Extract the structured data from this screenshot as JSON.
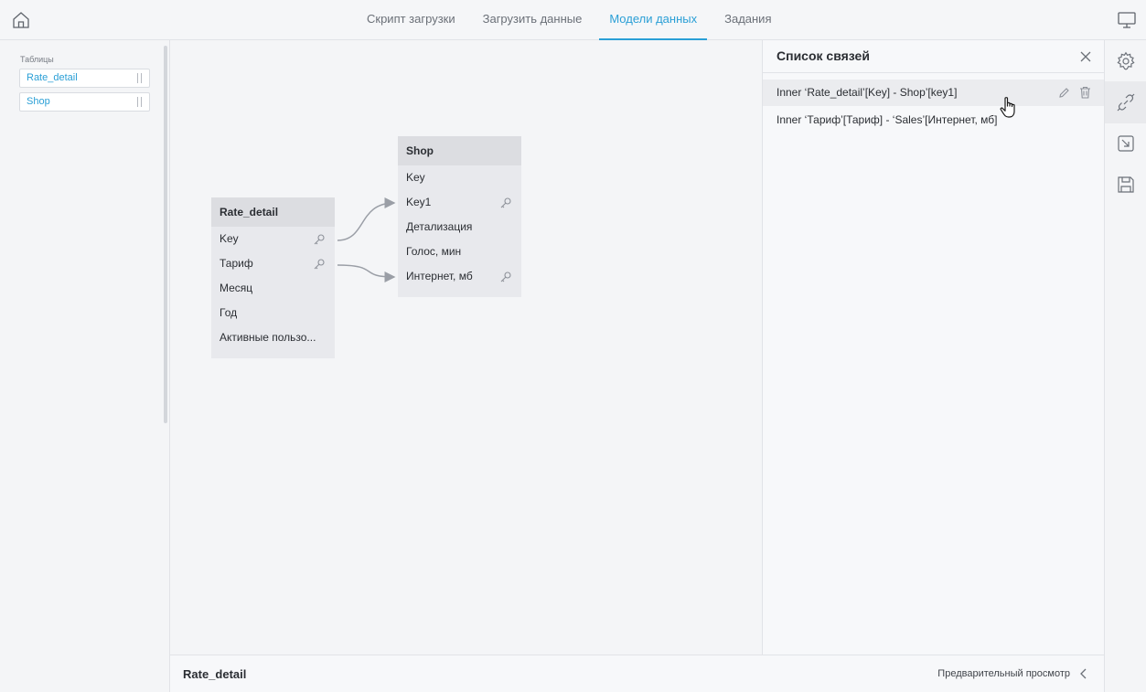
{
  "topbar": {
    "home_icon": "home-icon",
    "monitor_icon": "monitor-icon",
    "tabs": [
      {
        "label": "Скрипт загрузки",
        "active": false
      },
      {
        "label": "Загрузить данные",
        "active": false
      },
      {
        "label": "Модели данных",
        "active": true
      },
      {
        "label": "Задания",
        "active": false
      }
    ]
  },
  "sidebar": {
    "title": "Таблицы",
    "tables": [
      "Rate_detail",
      "Shop"
    ]
  },
  "model": {
    "entities": [
      {
        "name": "Rate_detail",
        "fields": [
          {
            "label": "Key",
            "key": true
          },
          {
            "label": "Тариф",
            "key": true
          },
          {
            "label": "Месяц",
            "key": false
          },
          {
            "label": "Год",
            "key": false
          },
          {
            "label": "Активные пользо...",
            "key": false
          }
        ]
      },
      {
        "name": "Shop",
        "fields": [
          {
            "label": "Key",
            "key": false
          },
          {
            "label": "Key1",
            "key": true
          },
          {
            "label": "Детализация",
            "key": false
          },
          {
            "label": "Голос, мин",
            "key": false
          },
          {
            "label": "Интернет, мб",
            "key": true
          }
        ]
      }
    ]
  },
  "links_panel": {
    "title": "Список связей",
    "items": [
      {
        "text": "Inner ‘Rate_detail’[Key] - Shop’[key1]",
        "hovered": true
      },
      {
        "text": "Inner ‘Тариф’[Тариф] - ‘Sales’[Интернет, мб]",
        "hovered": false
      }
    ]
  },
  "toolbar": {
    "icons": [
      "gear-icon",
      "link-icon",
      "import-icon",
      "save-icon"
    ],
    "active": "link-icon"
  },
  "footer": {
    "table_name": "Rate_detail",
    "preview_label": "Предварительный просмотр"
  },
  "colors": {
    "accent": "#2a9fd6",
    "background": "#f4f5f7",
    "entity_header": "#dcdde1",
    "entity_body": "#e8e9ed"
  }
}
